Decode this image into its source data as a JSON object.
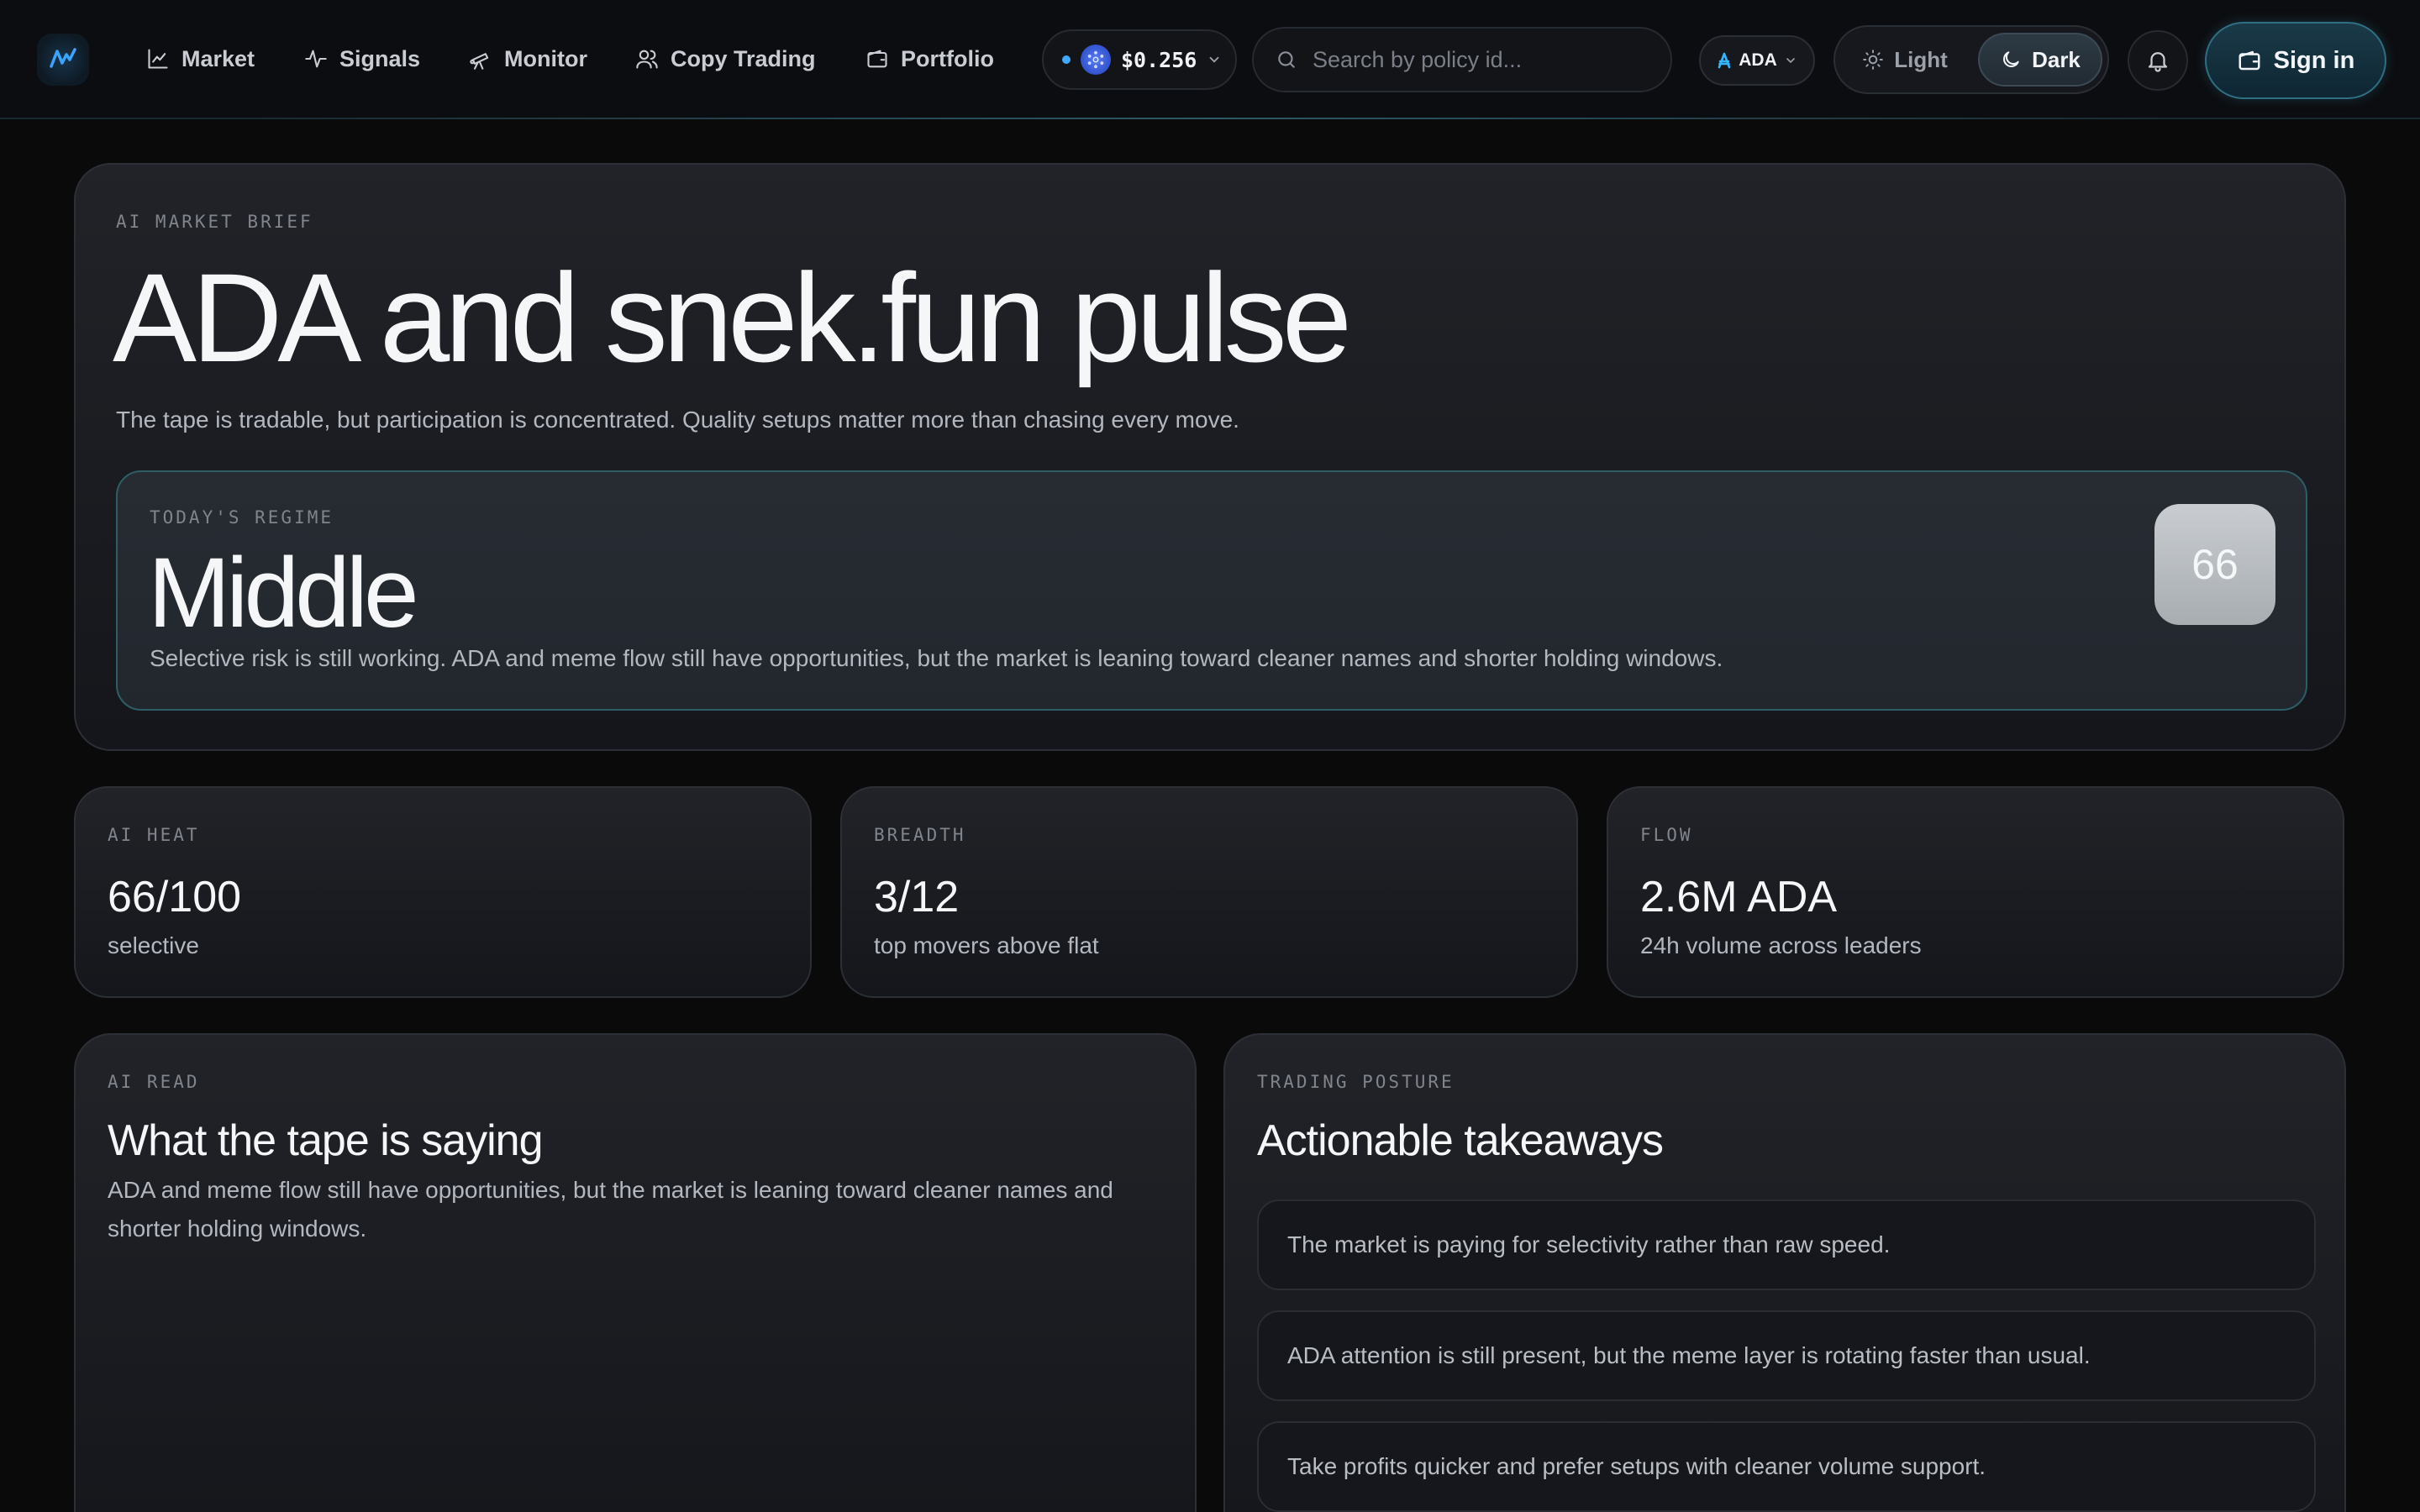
{
  "nav": {
    "links": [
      {
        "label": "Market",
        "icon": "chart-line-icon"
      },
      {
        "label": "Signals",
        "icon": "activity-icon"
      },
      {
        "label": "Monitor",
        "icon": "telescope-icon"
      },
      {
        "label": "Copy Trading",
        "icon": "users-icon"
      },
      {
        "label": "Portfolio",
        "icon": "wallet-icon"
      }
    ],
    "price": "$0.256",
    "search_placeholder": "Search by policy id...",
    "currency": "ADA",
    "theme": {
      "light_label": "Light",
      "dark_label": "Dark",
      "active": "Dark"
    },
    "signin_label": "Sign in",
    "accent": "#2f6f84"
  },
  "hero": {
    "eyebrow": "AI MARKET BRIEF",
    "title": "ADA and snek.fun pulse",
    "subtitle": "The tape is tradable, but participation is concentrated. Quality setups matter more than chasing every move.",
    "regime": {
      "eyebrow": "TODAY'S REGIME",
      "title": "Middle",
      "description": "Selective risk is still working. ADA and meme flow still have opportunities, but the market is leaning toward cleaner names and shorter holding windows.",
      "score": "66"
    }
  },
  "stats": [
    {
      "eyebrow": "AI HEAT",
      "value": "66/100",
      "sub": "selective"
    },
    {
      "eyebrow": "BREADTH",
      "value": "3/12",
      "sub": "top movers above flat"
    },
    {
      "eyebrow": "FLOW",
      "value": "2.6M ADA",
      "sub": "24h volume across leaders"
    }
  ],
  "ai_read": {
    "eyebrow": "AI READ",
    "title": "What the tape is saying",
    "description": "ADA and meme flow still have opportunities, but the market is leaning toward cleaner names and shorter holding windows."
  },
  "posture": {
    "eyebrow": "TRADING POSTURE",
    "title": "Actionable takeaways",
    "items": [
      "The market is paying for selectivity rather than raw speed.",
      "ADA attention is still present, but the meme layer is rotating faster than usual.",
      "Take profits quicker and prefer setups with cleaner volume support."
    ]
  }
}
